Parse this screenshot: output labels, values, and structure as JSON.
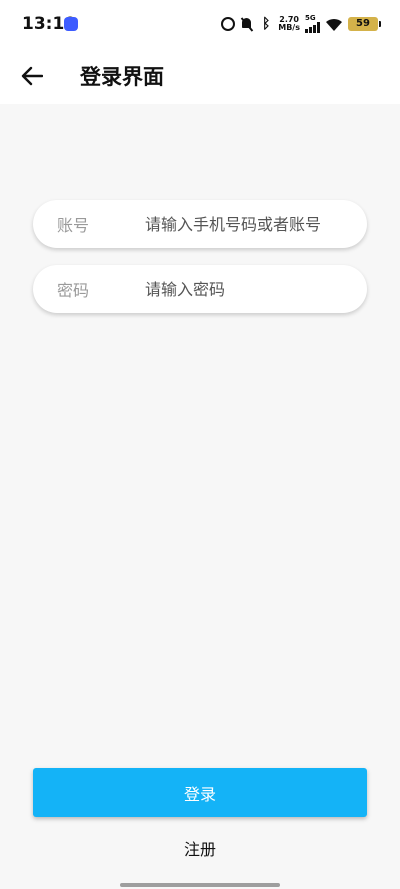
{
  "status_bar": {
    "time": "13:10",
    "net_speed_value": "2.70",
    "net_speed_unit": "MB/s",
    "network_type": "5G",
    "battery_level": "59",
    "battery_color": "#d4b24a",
    "icons": [
      "app-badge-icon",
      "alarm-icon",
      "mute-icon",
      "bluetooth-icon",
      "signal-icon",
      "wifi-icon",
      "battery-icon"
    ]
  },
  "app_bar": {
    "title": "登录界面",
    "back_icon": "arrow-left-icon"
  },
  "form": {
    "account": {
      "label": "账号",
      "placeholder": "请输入手机号码或者账号",
      "value": ""
    },
    "password": {
      "label": "密码",
      "placeholder": "请输入密码",
      "value": ""
    }
  },
  "actions": {
    "login_label": "登录",
    "register_label": "注册",
    "accent_color": "#14b3f7"
  }
}
